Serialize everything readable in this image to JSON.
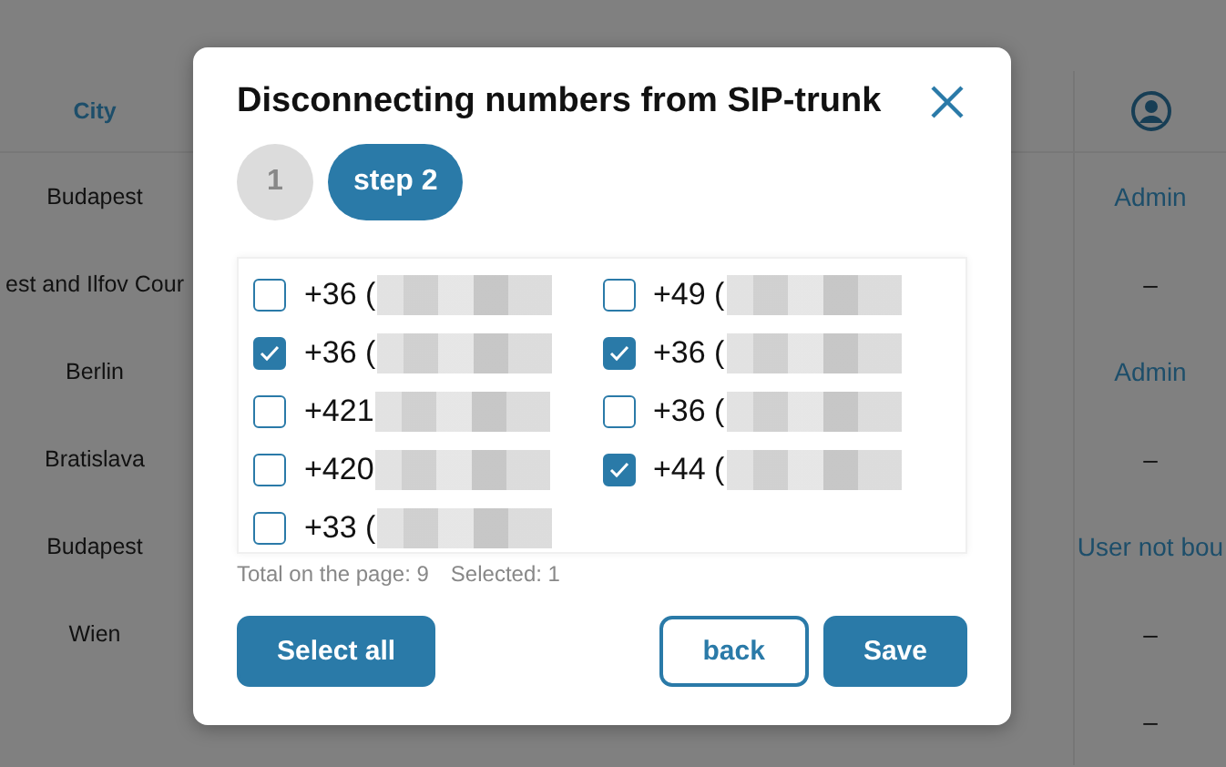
{
  "table": {
    "city_header": "City",
    "rows": [
      {
        "city": "Budapest",
        "user": "Admin",
        "user_is_link": true
      },
      {
        "city": "est and Ilfov Cour",
        "user": "–",
        "user_is_link": false
      },
      {
        "city": "Berlin",
        "user": "Admin",
        "user_is_link": true
      },
      {
        "city": "Bratislava",
        "user": "–",
        "user_is_link": false
      },
      {
        "city": "Budapest",
        "user": "User not bou",
        "user_is_link": true
      },
      {
        "city": "Wien",
        "user": "–",
        "user_is_link": false
      },
      {
        "user": "–",
        "user_is_link": false
      }
    ]
  },
  "dialog": {
    "title": "Disconnecting numbers from SIP-trunk",
    "steps": [
      {
        "label": "1",
        "selected": false
      },
      {
        "label": "step 2",
        "selected": true
      }
    ],
    "number_columns": [
      [
        {
          "prefix": "+36 (",
          "checked": false
        },
        {
          "prefix": "+36 (",
          "checked": true
        },
        {
          "prefix": "+421",
          "checked": false
        },
        {
          "prefix": "+420",
          "checked": false
        },
        {
          "prefix": "+33 (",
          "checked": false
        }
      ],
      [
        {
          "prefix": "+49 (",
          "checked": false
        },
        {
          "prefix": "+36 (",
          "checked": true
        },
        {
          "prefix": "+36 (",
          "checked": false
        },
        {
          "prefix": "+44 (",
          "checked": true
        }
      ]
    ],
    "total": "Total on the page: 9",
    "selected_count": "Selected: 1",
    "buttons": [
      {
        "label": "Select all",
        "kind": "primary"
      },
      {
        "label": "back",
        "kind": "outline"
      },
      {
        "label": "Save",
        "kind": "primary"
      }
    ]
  }
}
